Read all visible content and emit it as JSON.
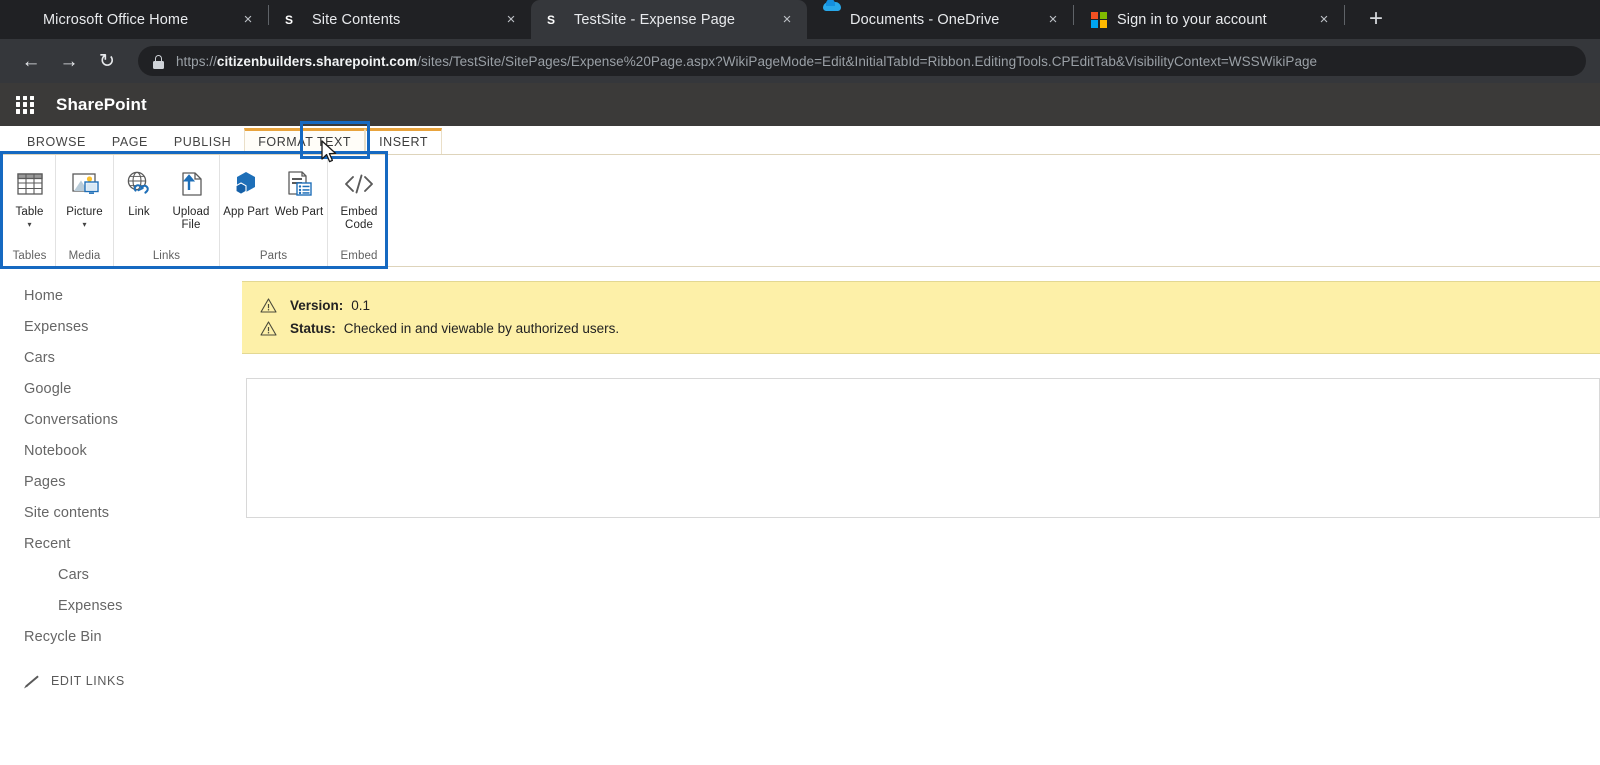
{
  "browser": {
    "tabs": [
      {
        "title": "Microsoft Office Home",
        "favicon": "office-icon",
        "close": "×"
      },
      {
        "title": "Site Contents",
        "favicon": "sharepoint-icon",
        "close": "×"
      },
      {
        "title": "TestSite - Expense Page",
        "favicon": "sharepoint-icon",
        "close": "×"
      },
      {
        "title": "Documents - OneDrive",
        "favicon": "onedrive-icon",
        "close": "×"
      },
      {
        "title": "Sign in to your account",
        "favicon": "microsoft-icon",
        "close": "×"
      }
    ],
    "new_tab_label": "+",
    "nav": {
      "back": "←",
      "forward": "→",
      "reload": "↻"
    },
    "url": {
      "scheme": "https://",
      "host": "citizenbuilders.sharepoint.com",
      "path": "/sites/TestSite/SitePages/Expense%20Page.aspx?WikiPageMode=Edit&InitialTabId=Ribbon.EditingTools.CPEditTab&VisibilityContext=WSSWikiPage",
      "full": "https://citizenbuilders.sharepoint.com/sites/TestSite/SitePages/Expense%20Page.aspx?WikiPageMode=Edit&InitialTabId=Ribbon.EditingTools.CPEditTab&VisibilityContext=WSSWikiPage"
    }
  },
  "suitebar": {
    "app_launcher": "waffle-icon",
    "title": "SharePoint"
  },
  "ribbon": {
    "tabs": [
      {
        "label": "BROWSE",
        "contextual": false,
        "active": false
      },
      {
        "label": "PAGE",
        "contextual": false,
        "active": false
      },
      {
        "label": "PUBLISH",
        "contextual": false,
        "active": false
      },
      {
        "label": "FORMAT TEXT",
        "contextual": true,
        "active": false
      },
      {
        "label": "INSERT",
        "contextual": true,
        "active": true
      }
    ],
    "groups": [
      {
        "label": "Tables",
        "buttons": [
          {
            "label": "Table",
            "icon": "table-icon",
            "caret": "▾"
          }
        ]
      },
      {
        "label": "Media",
        "buttons": [
          {
            "label": "Picture",
            "icon": "picture-icon",
            "caret": "▾"
          }
        ]
      },
      {
        "label": "Links",
        "buttons": [
          {
            "label": "Link",
            "icon": "link-globe-icon",
            "caret": ""
          },
          {
            "label": "Upload File",
            "icon": "upload-file-icon",
            "caret": ""
          }
        ]
      },
      {
        "label": "Parts",
        "buttons": [
          {
            "label": "App Part",
            "icon": "app-part-icon",
            "caret": ""
          },
          {
            "label": "Web Part",
            "icon": "web-part-icon",
            "caret": ""
          }
        ]
      },
      {
        "label": "Embed",
        "buttons": [
          {
            "label": "Embed Code",
            "icon": "embed-code-icon",
            "caret": ""
          }
        ]
      }
    ]
  },
  "sidebar": {
    "items": [
      {
        "label": "Home",
        "sub": false
      },
      {
        "label": "Expenses",
        "sub": false
      },
      {
        "label": "Cars",
        "sub": false
      },
      {
        "label": "Google",
        "sub": false
      },
      {
        "label": "Conversations",
        "sub": false
      },
      {
        "label": "Notebook",
        "sub": false
      },
      {
        "label": "Pages",
        "sub": false
      },
      {
        "label": "Site contents",
        "sub": false
      },
      {
        "label": "Recent",
        "sub": false
      },
      {
        "label": "Cars",
        "sub": true
      },
      {
        "label": "Expenses",
        "sub": true
      },
      {
        "label": "Recycle Bin",
        "sub": false
      }
    ],
    "edit_links": {
      "label": "EDIT LINKS",
      "icon": "pencil-icon"
    }
  },
  "status_banner": {
    "rows": [
      {
        "icon": "warning-icon",
        "label": "Version:",
        "value": "0.1"
      },
      {
        "icon": "warning-icon",
        "label": "Status:",
        "value": "Checked in and viewable by authorized users."
      }
    ]
  },
  "editor": {
    "placeholder": "",
    "value": ""
  },
  "annotations": {
    "highlight_color": "#1669c1",
    "contextual_tab_color": "#e8a33d",
    "banner_color": "#fdf0a8"
  }
}
